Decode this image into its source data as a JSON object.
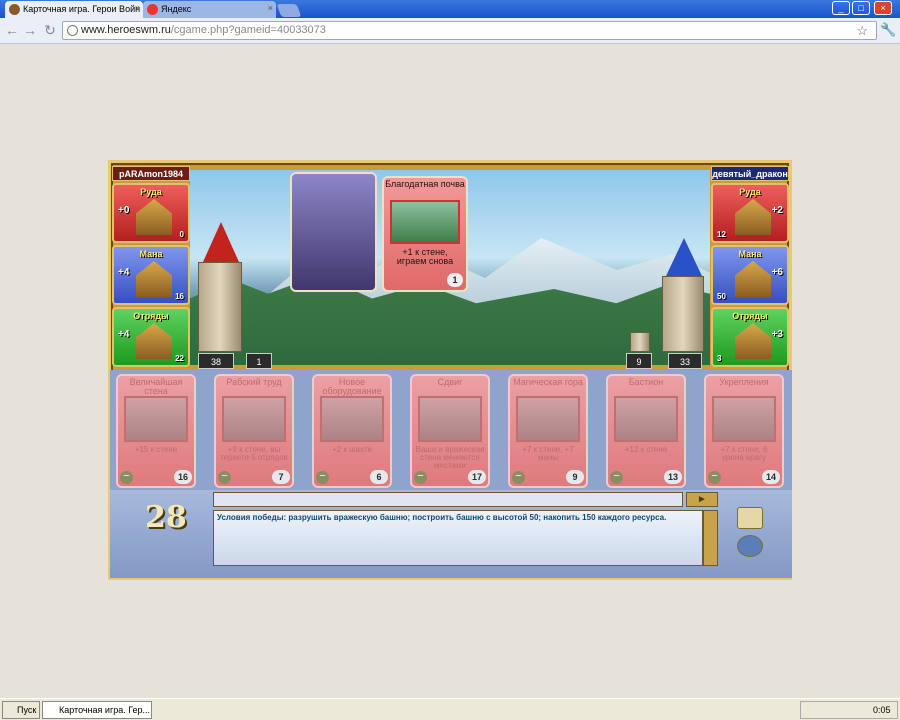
{
  "browser": {
    "tabs": [
      {
        "label": "Карточная игра. Герои Войн"
      },
      {
        "label": "Яндекс"
      }
    ],
    "url_host": "www.heroeswm.ru",
    "url_path": "/cgame.php?gameid=40033073"
  },
  "left_player": {
    "name": "pARAmon1984",
    "resources": [
      {
        "label": "Руда",
        "inc": "+0",
        "amount": "0"
      },
      {
        "label": "Мана",
        "inc": "+4",
        "amount": "16"
      },
      {
        "label": "Отряды",
        "inc": "+4",
        "amount": "22"
      }
    ],
    "tower": "38",
    "wall": "1"
  },
  "right_player": {
    "name": "девятый_дракон",
    "resources": [
      {
        "label": "Руда",
        "inc": "+2",
        "amount": "12"
      },
      {
        "label": "Мана",
        "inc": "+6",
        "amount": "50"
      },
      {
        "label": "Отряды",
        "inc": "+3",
        "amount": "3"
      }
    ],
    "tower": "33",
    "wall": "9"
  },
  "played_card": {
    "name": "Благодатная почва",
    "desc": "+1 к стене, играем снова",
    "cost": "1"
  },
  "hand": [
    {
      "name": "Величайшая стена",
      "desc": "+15 к стене",
      "cost": "16"
    },
    {
      "name": "Рабский труд",
      "desc": "+9 к стене, вы теряете 5 отрядов",
      "cost": "7"
    },
    {
      "name": "Новое оборудование",
      "desc": "+2 к шахте",
      "cost": "6"
    },
    {
      "name": "Сдвиг",
      "desc": "Ваша и вражеская стена меняются местами",
      "cost": "17"
    },
    {
      "name": "Магическая гора",
      "desc": "+7 к стене, +7 маны",
      "cost": "9"
    },
    {
      "name": "Бастион",
      "desc": "+12 к стене",
      "cost": "13"
    },
    {
      "name": "Укрепления",
      "desc": "+7 к стене, 6 урона врагу",
      "cost": "14"
    }
  ],
  "turn": "28",
  "log": "Условия победы: разрушить вражескую башню; построить башню с высотой 50; накопить 150 каждого ресурса.",
  "taskbar": {
    "start": "Пуск",
    "task": "Карточная игра. Гер...",
    "clock": "0:05"
  }
}
